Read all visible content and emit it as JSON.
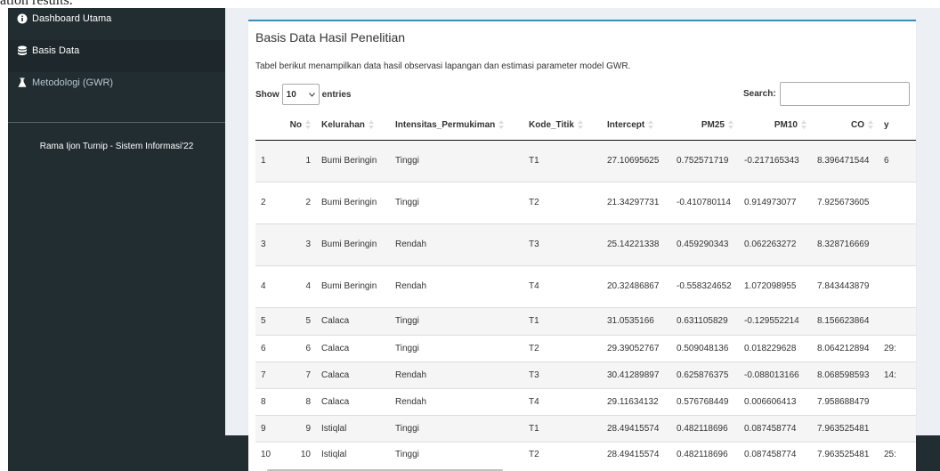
{
  "top_fragment": "ation results.",
  "sidebar": {
    "items": [
      {
        "label": "Dashboard Utama",
        "icon": "info-circle-icon"
      },
      {
        "label": "Basis Data",
        "icon": "database-icon"
      },
      {
        "label": "Metodologi (GWR)",
        "icon": "flask-icon"
      }
    ],
    "footer": "Rama Ijon Turnip - Sistem Informasi'22"
  },
  "box": {
    "title": "Basis Data Hasil Penelitian",
    "description": "Tabel berikut menampilkan data hasil observasi lapangan dan estimasi parameter model GWR.",
    "length": {
      "prefix": "Show",
      "selected": "10",
      "suffix": "entries"
    },
    "search_label": "Search:",
    "search_value": ""
  },
  "table": {
    "columns": [
      "",
      "No",
      "Kelurahan",
      "Intensitas_Permukiman",
      "Kode_Titik",
      "Intercept",
      "PM25",
      "PM10",
      "CO",
      "y"
    ],
    "rows": [
      [
        "1",
        "1",
        "Bumi Beringin",
        "Tinggi",
        "T1",
        "27.10695625",
        "0.752571719",
        "-0.217165343",
        "8.396471544",
        "6"
      ],
      [
        "2",
        "2",
        "Bumi Beringin",
        "Tinggi",
        "T2",
        "21.34297731",
        "-0.410780114",
        "0.914973077",
        "7.925673605",
        ""
      ],
      [
        "3",
        "3",
        "Bumi Beringin",
        "Rendah",
        "T3",
        "25.14221338",
        "0.459290343",
        "0.062263272",
        "8.328716669",
        ""
      ],
      [
        "4",
        "4",
        "Bumi Beringin",
        "Rendah",
        "T4",
        "20.32486867",
        "-0.558324652",
        "1.072098955",
        "7.843443879",
        ""
      ],
      [
        "5",
        "5",
        "Calaca",
        "Tinggi",
        "T1",
        "31.0535166",
        "0.631105829",
        "-0.129552214",
        "8.156623864",
        ""
      ],
      [
        "6",
        "6",
        "Calaca",
        "Tinggi",
        "T2",
        "29.39052767",
        "0.509048136",
        "0.018229628",
        "8.064212894",
        "29:"
      ],
      [
        "7",
        "7",
        "Calaca",
        "Rendah",
        "T3",
        "30.41289897",
        "0.625876375",
        "-0.088013166",
        "8.068598593",
        "14:"
      ],
      [
        "8",
        "8",
        "Calaca",
        "Rendah",
        "T4",
        "29.11634132",
        "0.576768449",
        "0.006606413",
        "7.958688479",
        ""
      ],
      [
        "9",
        "9",
        "Istiqlal",
        "Tinggi",
        "T1",
        "28.49415574",
        "0.482118696",
        "0.087458774",
        "7.963525481",
        ""
      ],
      [
        "10",
        "10",
        "Istiqlal",
        "Tinggi",
        "T2",
        "28.49415574",
        "0.482118696",
        "0.087458774",
        "7.963525481",
        "25:"
      ]
    ]
  },
  "colors": {
    "sidebar_bg": "#222d32",
    "sidebar_active": "#1e282c",
    "accent": "#3c8dbc",
    "content_bg": "#ecf0f5"
  }
}
